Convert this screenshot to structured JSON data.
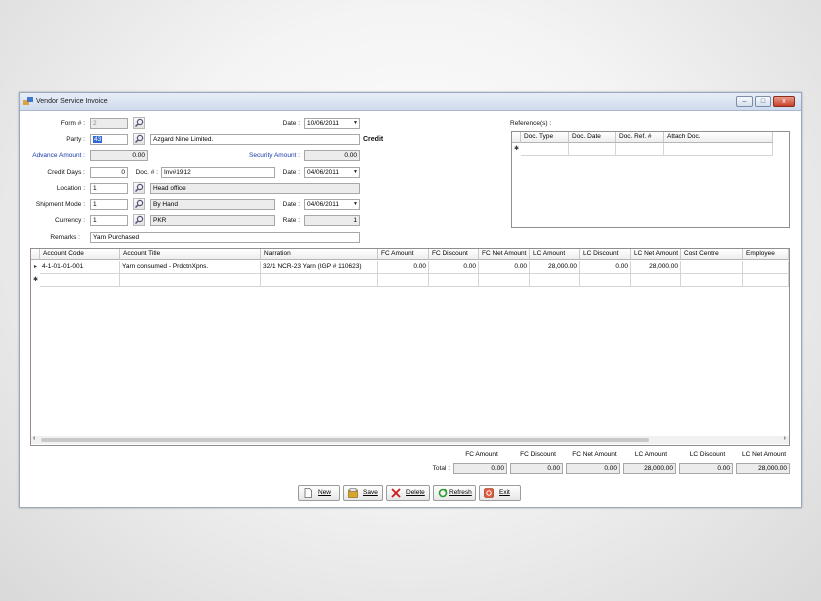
{
  "window": {
    "title": "Vendor Service Invoice",
    "minimize": "–",
    "maximize": "□",
    "close": "x"
  },
  "form": {
    "form_no_label": "Form # :",
    "form_no": "2",
    "date_label": "Date :",
    "date": "10/06/2011",
    "party_label": "Party :",
    "party_code": "43",
    "party_name": "Azgard Nine Limited.",
    "party_type": "Credit",
    "advance_label": "Advance Amount :",
    "advance": "0.00",
    "security_label": "Security Amount :",
    "security": "0.00",
    "credit_days_label": "Credit Days :",
    "credit_days": "0",
    "doc_no_label": "Doc. # :",
    "doc_no": "Inv#1912",
    "doc_date_label": "Date :",
    "doc_date": "04/06/2011",
    "location_label": "Location :",
    "location_code": "1",
    "location_name": "Head office",
    "shipment_label": "Shipment Mode :",
    "shipment_code": "1",
    "shipment_name": "By Hand",
    "ship_date_label": "Date :",
    "ship_date": "04/06/2011",
    "currency_label": "Currency :",
    "currency_code": "1",
    "currency_name": "PKR",
    "rate_label": "Rate :",
    "rate": "1",
    "remarks_label": "Remarks :",
    "remarks": "Yarn Purchased",
    "references_label": "Reference(s) :"
  },
  "ref_grid": {
    "columns": [
      "Doc. Type",
      "Doc. Date",
      "Doc. Ref. #",
      "Attach Doc."
    ],
    "new_row_marker": "✱"
  },
  "detail_grid": {
    "columns": [
      "Account Code",
      "Account Title",
      "Narration",
      "FC Amount",
      "FC Discount",
      "FC Net Amount",
      "LC Amount",
      "LC Discount",
      "LC Net Amount",
      "Cost Centre",
      "Employee"
    ],
    "rows": [
      [
        "4-1-01-01-001",
        "Yarn consumed - PrdctnXpns.",
        "32/1 NCR-23 Yarn (IGP # 110623)",
        "0.00",
        "0.00",
        "0.00",
        "28,000.00",
        "0.00",
        "28,000.00",
        "",
        ""
      ]
    ],
    "current_row_marker": "▸",
    "new_row_marker": "✱",
    "scroll_left": "‹",
    "scroll_right": "›"
  },
  "totals": {
    "label": "Total :",
    "columns": [
      "FC Amount",
      "FC Discount",
      "FC Net Amount",
      "LC Amount",
      "LC Discount",
      "LC Net Amount"
    ],
    "values": [
      "0.00",
      "0.00",
      "0.00",
      "28,000.00",
      "0.00",
      "28,000.00"
    ]
  },
  "buttons": {
    "new": "New",
    "save": "Save",
    "delete": "Delete",
    "refresh": "Refresh",
    "exit": "Exit"
  },
  "dropdown_arrow": "▼"
}
